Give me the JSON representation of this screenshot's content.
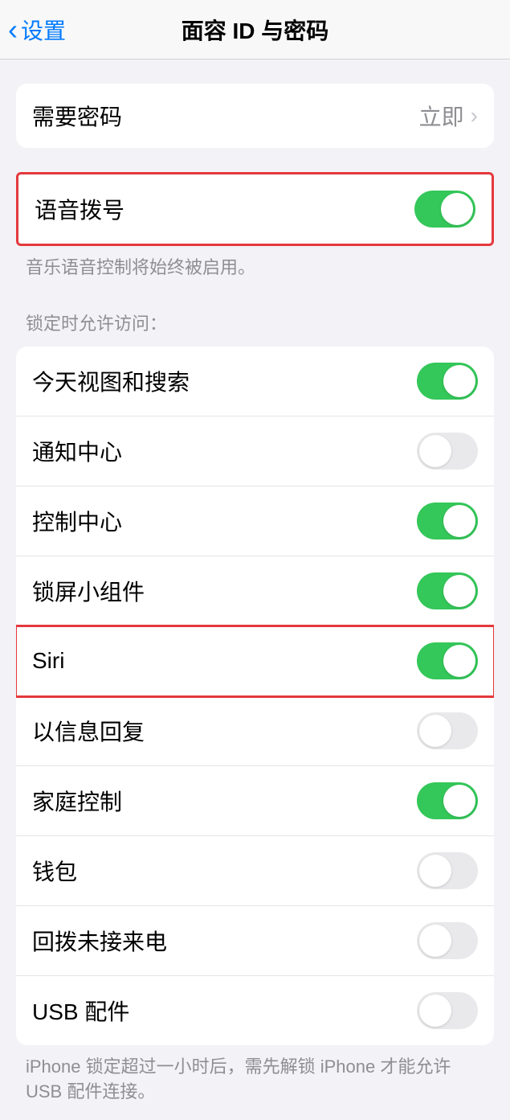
{
  "header": {
    "back_label": "设置",
    "title": "面容 ID 与密码"
  },
  "require_passcode": {
    "label": "需要密码",
    "value": "立即"
  },
  "voice_dial": {
    "label": "语音拨号",
    "enabled": true,
    "footer": "音乐语音控制将始终被启用。"
  },
  "lock_access": {
    "header": "锁定时允许访问：",
    "items": [
      {
        "label": "今天视图和搜索",
        "enabled": true
      },
      {
        "label": "通知中心",
        "enabled": false
      },
      {
        "label": "控制中心",
        "enabled": true
      },
      {
        "label": "锁屏小组件",
        "enabled": true
      },
      {
        "label": "Siri",
        "enabled": true
      },
      {
        "label": "以信息回复",
        "enabled": false
      },
      {
        "label": "家庭控制",
        "enabled": true
      },
      {
        "label": "钱包",
        "enabled": false
      },
      {
        "label": "回拨未接来电",
        "enabled": false
      },
      {
        "label": "USB 配件",
        "enabled": false
      }
    ],
    "footer": "iPhone 锁定超过一小时后，需先解锁 iPhone 才能允许 USB 配件连接。"
  }
}
